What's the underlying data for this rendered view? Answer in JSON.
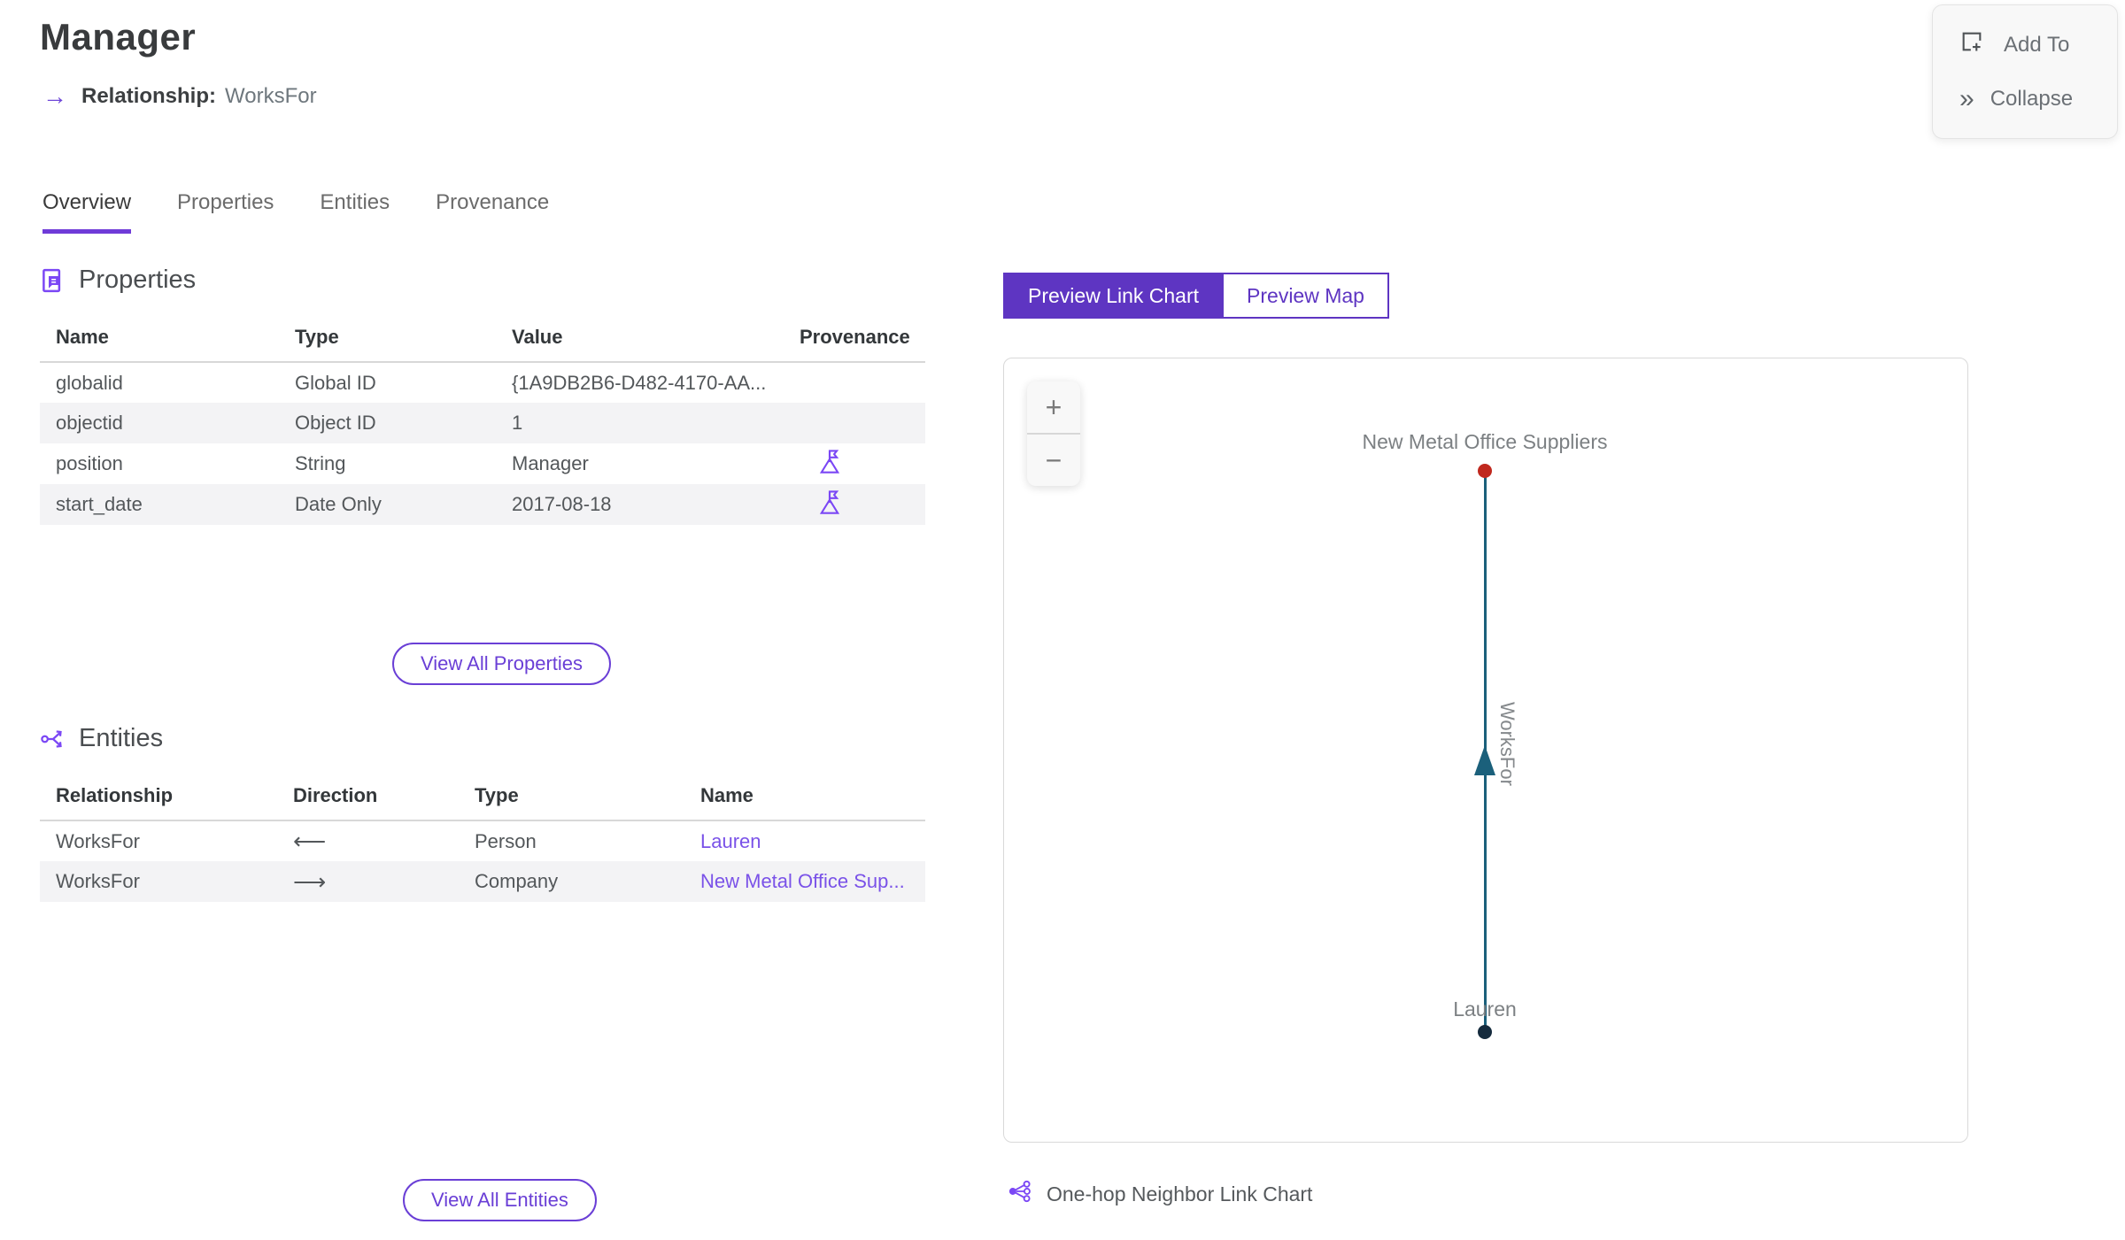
{
  "colors": {
    "accent_purple": "#5e35c2",
    "icon_purple": "#7b47f5",
    "link_purple": "#7a52e8",
    "edge_teal": "#1b607b",
    "node_red": "#c0281e",
    "node_navy": "#152b3d",
    "row_stripe": "#f3f3f5"
  },
  "header": {
    "title": "Manager",
    "arrow_glyph": "→",
    "relationship_label": "Relationship:",
    "relationship_value": "WorksFor"
  },
  "actions_panel": {
    "add_to": "Add To",
    "collapse": "Collapse",
    "collapse_glyph": "»"
  },
  "tabs": [
    {
      "label": "Overview",
      "active": true
    },
    {
      "label": "Properties",
      "active": false
    },
    {
      "label": "Entities",
      "active": false
    },
    {
      "label": "Provenance",
      "active": false
    }
  ],
  "properties_section": {
    "title": "Properties",
    "columns": [
      "Name",
      "Type",
      "Value",
      "Provenance"
    ],
    "rows": [
      {
        "name": "globalid",
        "type": "Global ID",
        "value": "{1A9DB2B6-D482-4170-AA...",
        "provenance": false
      },
      {
        "name": "objectid",
        "type": "Object ID",
        "value": "1",
        "provenance": false
      },
      {
        "name": "position",
        "type": "String",
        "value": "Manager",
        "provenance": true
      },
      {
        "name": "start_date",
        "type": "Date Only",
        "value": "2017-08-18",
        "provenance": true
      }
    ],
    "view_all_label": "View All Properties"
  },
  "entities_section": {
    "title": "Entities",
    "columns": [
      "Relationship",
      "Direction",
      "Type",
      "Name"
    ],
    "rows": [
      {
        "relationship": "WorksFor",
        "direction": "⟵",
        "type": "Person",
        "name": "Lauren"
      },
      {
        "relationship": "WorksFor",
        "direction": "⟶",
        "type": "Company",
        "name": "New Metal Office Sup..."
      }
    ],
    "view_all_label": "View All Entities"
  },
  "preview": {
    "link_chart_label": "Preview Link Chart",
    "map_label": "Preview Map",
    "zoom_in": "+",
    "zoom_out": "−",
    "caption": "One-hop Neighbor Link Chart"
  },
  "link_chart": {
    "nodes": [
      {
        "label": "New Metal Office Suppliers",
        "color": "#c0281e",
        "position": "top"
      },
      {
        "label": "Lauren",
        "color": "#152b3d",
        "position": "bottom"
      }
    ],
    "edge": {
      "label": "WorksFor",
      "from": "Lauren",
      "to": "New Metal Office Suppliers",
      "direction": "up",
      "color": "#1b607b"
    }
  }
}
